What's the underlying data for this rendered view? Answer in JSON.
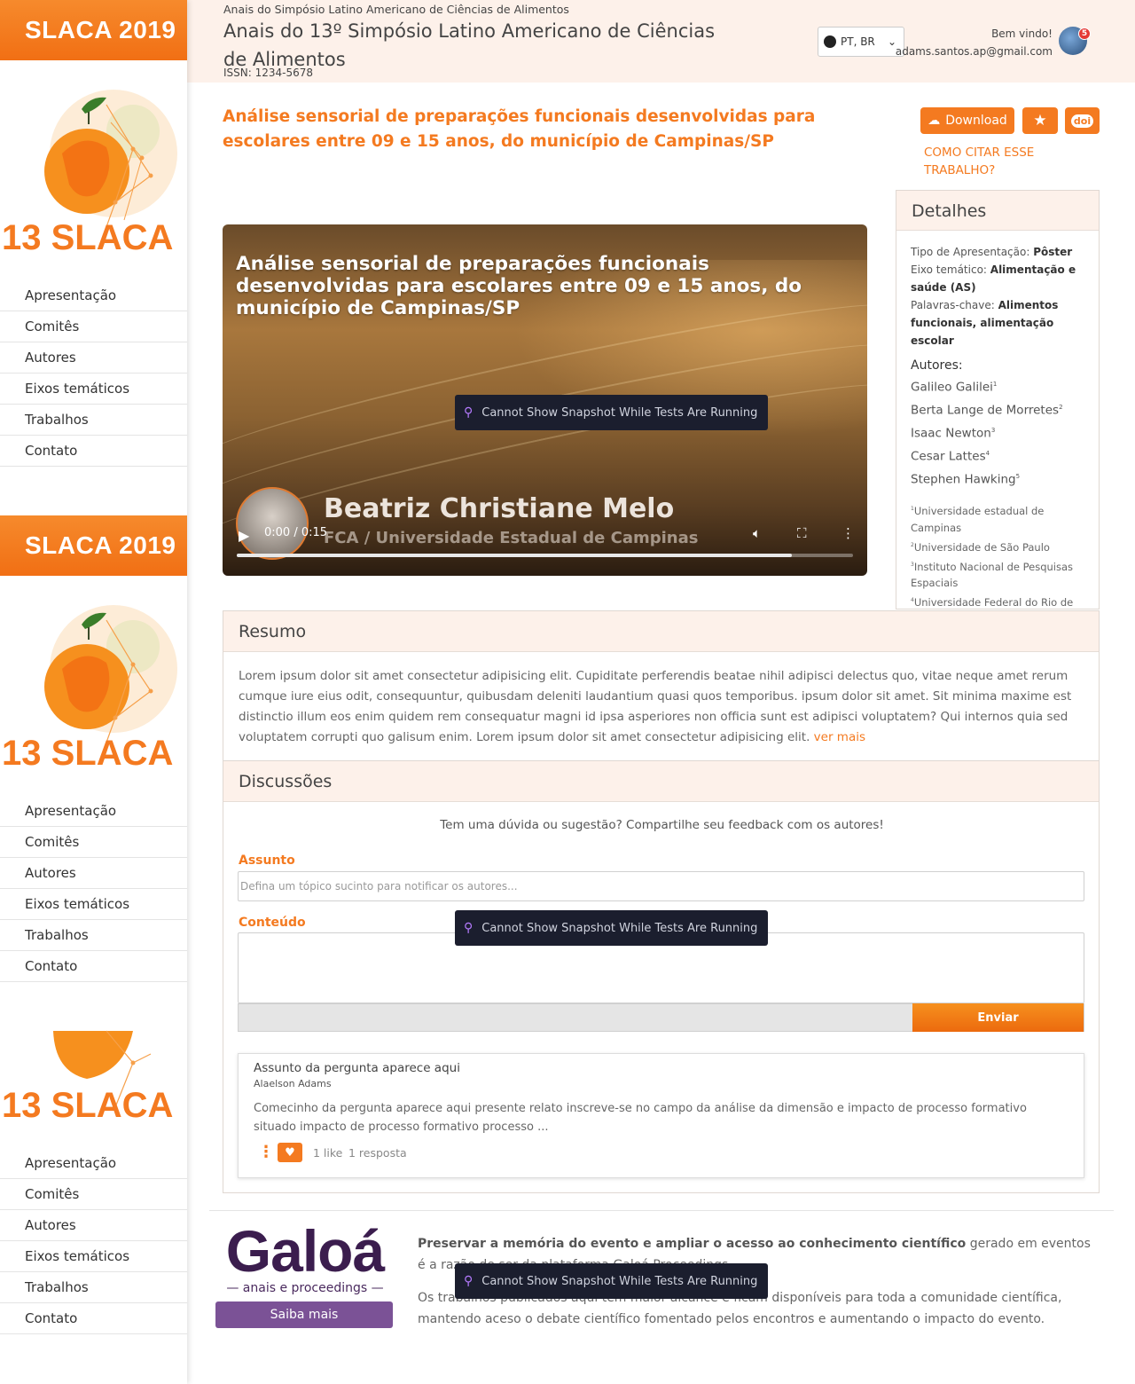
{
  "sidebar": {
    "brand": "SLACA 2019",
    "logo_text": "13 SLACA",
    "nav": [
      "Apresentação",
      "Comitês",
      "Autores",
      "Eixos temáticos",
      "Trabalhos",
      "Contato"
    ]
  },
  "header": {
    "sup_title": "Anais do Simpósio Latino Americano de Ciências de Alimentos",
    "title": "Anais do 13º Simpósio Latino Americano de Ciências de Alimentos",
    "issn": "ISSN: 1234-5678",
    "language": "PT, BR",
    "welcome": "Bem vindo!",
    "email": "adams.santos.ap@gmail.com",
    "notifications": "5"
  },
  "paper": {
    "title": "Análise sensorial de preparações funcionais desenvolvidas para escolares entre 09 e 15 anos, do município de Campinas/SP",
    "download_label": "Download",
    "star_icon": "★",
    "doi_label": "doi",
    "cite_label": "COMO CITAR ESSE TRABALHO?"
  },
  "video": {
    "title": "Análise sensorial de preparações funcionais desenvolvidas para escolares entre 09 e 15 anos, do município de Campinas/SP",
    "speaker": "Beatriz Christiane Melo",
    "affiliation": "FCA / Universidade Estadual de Campinas",
    "time": "0:00 / 0:15",
    "progress_fraction": 0.9
  },
  "snapshot_notice": "Cannot Show Snapshot While Tests Are Running",
  "details": {
    "heading": "Detalhes",
    "type_label": "Tipo de Apresentação: ",
    "type_value": "Pôster",
    "axis_label": "Eixo temático: ",
    "axis_value": "Alimentação e saúde (AS)",
    "keywords_label": "Palavras-chave: ",
    "keywords_value": "Alimentos funcionais, alimentação escolar",
    "authors_label": "Autores:",
    "authors": [
      {
        "name": "Galileo Galilei",
        "sup": "1"
      },
      {
        "name": "Berta Lange de Morretes",
        "sup": "2"
      },
      {
        "name": "Isaac Newton",
        "sup": "3"
      },
      {
        "name": "Cesar Lattes",
        "sup": "4"
      },
      {
        "name": "Stephen Hawking",
        "sup": "5"
      }
    ],
    "affiliations": [
      {
        "sup": "1",
        "name": "Universidade estadual de Campinas"
      },
      {
        "sup": "2",
        "name": "Universidade de São Paulo"
      },
      {
        "sup": "3",
        "name": "Instituto Nacional de Pesquisas Espaciais"
      },
      {
        "sup": "4",
        "name": "Universidade Federal do Rio de Janeiro"
      }
    ]
  },
  "resumo": {
    "heading": "Resumo",
    "text": "Lorem ipsum dolor sit amet consectetur adipisicing elit. Cupiditate perferendis beatae nihil adipisci delectus quo, vitae neque amet rerum cumque iure eius odit, consequuntur, quibusdam deleniti laudantium quasi quos temporibus. ipsum dolor sit amet. Sit minima maxime est distinctio illum eos enim quidem rem consequatur magni id ipsa asperiores non officia sunt est adipisci voluptatem? Qui internos quia sed voluptatem corrupti quo galisum enim. Lorem ipsum dolor sit amet consectetur adipisicing elit.",
    "more": "ver mais"
  },
  "discussoes": {
    "heading": "Discussões",
    "prompt": "Tem uma dúvida ou sugestão? Compartilhe seu feedback com os autores!",
    "subject_label": "Assunto",
    "subject_placeholder": "Defina um tópico sucinto para notificar os autores...",
    "content_label": "Conteúdo",
    "send_label": "Enviar",
    "question": {
      "subject": "Assunto da pergunta aparece aqui",
      "author": "Alaelson Adams",
      "body": "Comecinho da pergunta aparece aqui presente relato inscreve-se no campo da análise da dimensão e impacto de processo formativo situado impacto de processo formativo processo ...",
      "likes": "1 like",
      "replies": "1 resposta"
    }
  },
  "footer": {
    "galoa_word": "Galoá",
    "galoa_sub": "anais e proceedings",
    "saiba_mais": "Saiba mais",
    "p1_bold": "Preservar a memória do evento e ampliar o acesso ao conhecimento científico",
    "p1_rest": " gerado em eventos é a razão de ser da plataforma Galoá Proceedings.",
    "p2": "Os trabalhos publicados aqui tem maior alcance e ficam disponíveis para toda a comunidade científica, mantendo aceso o debate científico fomentado pelos encontros e aumentando o impacto do evento."
  },
  "colors": {
    "accent": "#f47a20",
    "header_bg": "#fdf1ea",
    "galoa": "#7b5296"
  }
}
